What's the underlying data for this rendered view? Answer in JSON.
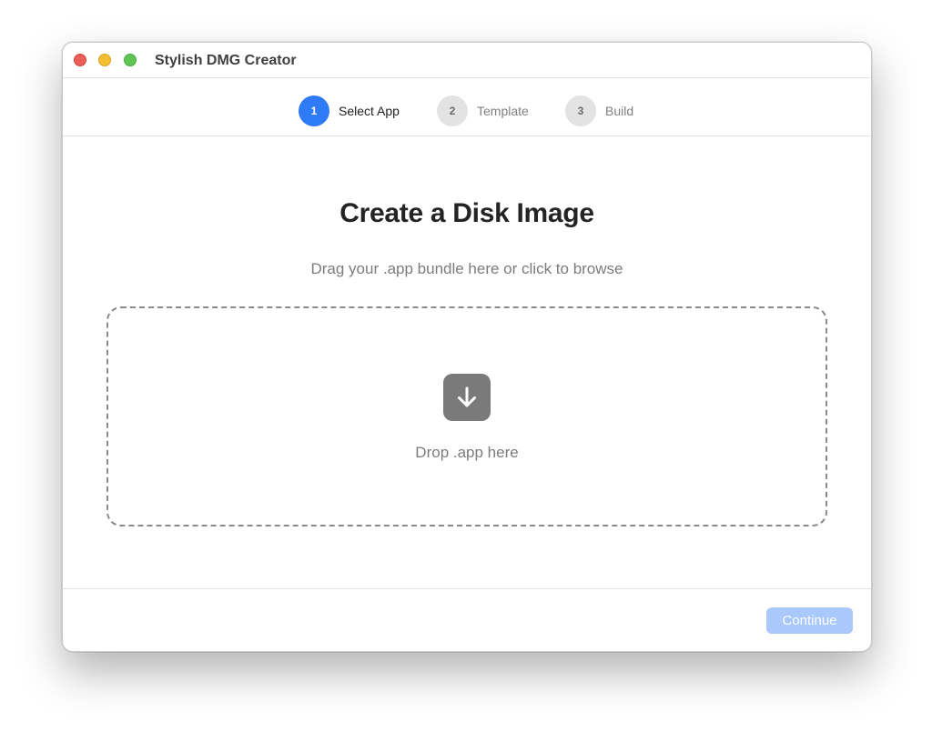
{
  "window": {
    "title": "Stylish DMG Creator"
  },
  "steps": [
    {
      "number": "1",
      "label": "Select App",
      "state": "active"
    },
    {
      "number": "2",
      "label": "Template",
      "state": "inactive"
    },
    {
      "number": "3",
      "label": "Build",
      "state": "inactive"
    }
  ],
  "main": {
    "heading": "Create a Disk Image",
    "subheading": "Drag your .app bundle here or click to browse",
    "dropzone": {
      "icon": "download-arrow-icon",
      "label": "Drop .app here"
    }
  },
  "footer": {
    "continue_label": "Continue",
    "continue_enabled": false
  },
  "colors": {
    "accent": "#2f7bf5",
    "accent_disabled": "#a9c8fb",
    "close": "#ec5f57",
    "minimize": "#f4bf33",
    "zoom": "#60c454"
  }
}
